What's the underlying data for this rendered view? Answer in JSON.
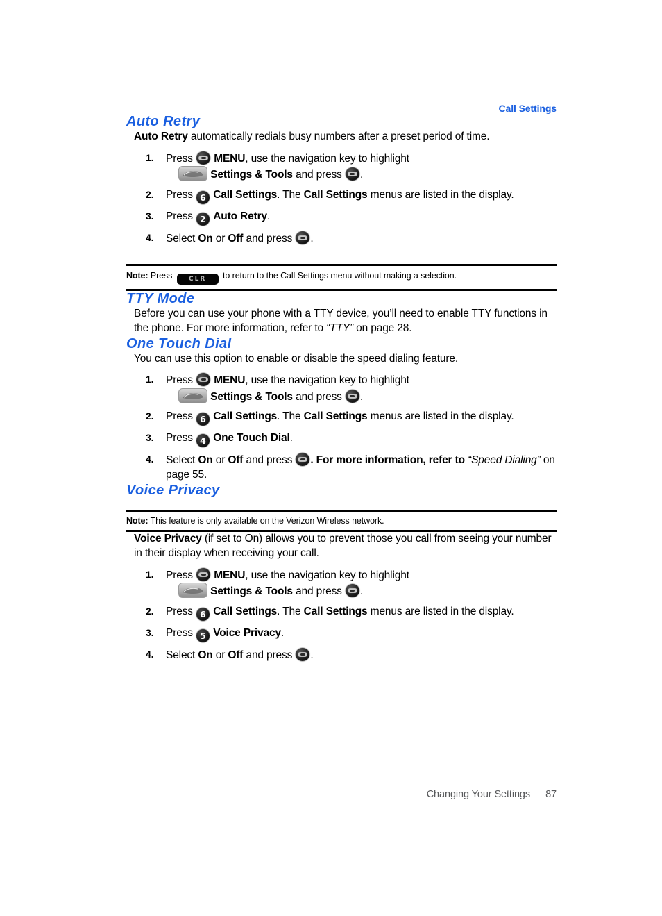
{
  "header": {
    "running_head": "Call Settings"
  },
  "footer": {
    "chapter": "Changing Your Settings",
    "page_number": "87"
  },
  "colors": {
    "heading_blue": "#1a5fe0",
    "footer_grey": "#58595b",
    "rule_black": "#000000"
  },
  "icons": {
    "ok_key": "ok-key-icon",
    "menu_key": "menu-key-icon",
    "tools_key": "settings-and-tools-key-icon",
    "clr_key": "clr-key-icon",
    "key_2": "2",
    "key_4": "4",
    "key_5": "5",
    "key_6": "6"
  },
  "sections": {
    "auto_retry": {
      "heading": "Auto Retry",
      "intro_bold": "Auto Retry",
      "intro_rest": " automatically redials busy numbers after a preset period of time.",
      "steps": [
        {
          "num": "1.",
          "line1_a": "Press ",
          "line1_b": "MENU",
          "line1_c": ", use the navigation key to highlight",
          "line2_a": "Settings & Tools",
          "line2_b": " and press ",
          "line2_c": "."
        },
        {
          "num": "2.",
          "a": "Press ",
          "b": "Call Settings",
          "c": ". The ",
          "d": "Call Settings",
          "e": " menus are listed in the display."
        },
        {
          "num": "3.",
          "a": "Press ",
          "b": "Auto Retry",
          "c": "."
        },
        {
          "num": "4.",
          "a": "Select ",
          "b": "On",
          "c": " or ",
          "d": "Off",
          "e": " and press ",
          "f": "."
        }
      ],
      "note": {
        "label": "Note:",
        "before": " Press ",
        "after": " to return to the Call Settings menu without making a selection."
      }
    },
    "tty_mode": {
      "heading": "TTY Mode",
      "body_a": "Before you can use your phone with a TTY device, you’ll need to enable TTY functions in the phone. For more information, refer to ",
      "body_italic": "“TTY”",
      "body_b": " on page 28."
    },
    "one_touch_dial": {
      "heading": "One Touch Dial",
      "intro": "You can use this option to enable or disable the speed dialing feature.",
      "steps": [
        {
          "num": "1.",
          "line1_a": "Press ",
          "line1_b": "MENU",
          "line1_c": ", use the navigation key to highlight",
          "line2_a": "Settings & Tools",
          "line2_b": " and press ",
          "line2_c": "."
        },
        {
          "num": "2.",
          "a": "Press ",
          "b": "Call Settings",
          "c": ". The ",
          "d": "Call Settings",
          "e": " menus are listed in the display."
        },
        {
          "num": "3.",
          "a": "Press ",
          "b": "One Touch Dial",
          "c": "."
        },
        {
          "num": "4.",
          "a": "Select ",
          "b": "On",
          "c": " or ",
          "d": "Off",
          "e": " and press ",
          "f": ". For more information, refer to ",
          "g": "“Speed Dialing”",
          "h": " on page 55."
        }
      ]
    },
    "voice_privacy": {
      "heading": "Voice Privacy",
      "note": {
        "label": "Note:",
        "text": " This feature is only available on the Verizon Wireless network."
      },
      "intro_bold": "Voice Privacy",
      "intro_rest": " (if set to On) allows you to prevent those you call from seeing your number in their display when receiving your call.",
      "steps": [
        {
          "num": "1.",
          "line1_a": "Press ",
          "line1_b": "MENU",
          "line1_c": ", use the navigation key to highlight",
          "line2_a": "Settings & Tools",
          "line2_b": " and press ",
          "line2_c": "."
        },
        {
          "num": "2.",
          "a": "Press ",
          "b": "Call Settings",
          "c": ". The ",
          "d": "Call Settings",
          "e": " menus are listed in the display."
        },
        {
          "num": "3.",
          "a": "Press ",
          "b": "Voice Privacy",
          "c": "."
        },
        {
          "num": "4.",
          "a": "Select ",
          "b": "On",
          "c": " or ",
          "d": "Off",
          "e": " and press ",
          "f": "."
        }
      ]
    }
  }
}
